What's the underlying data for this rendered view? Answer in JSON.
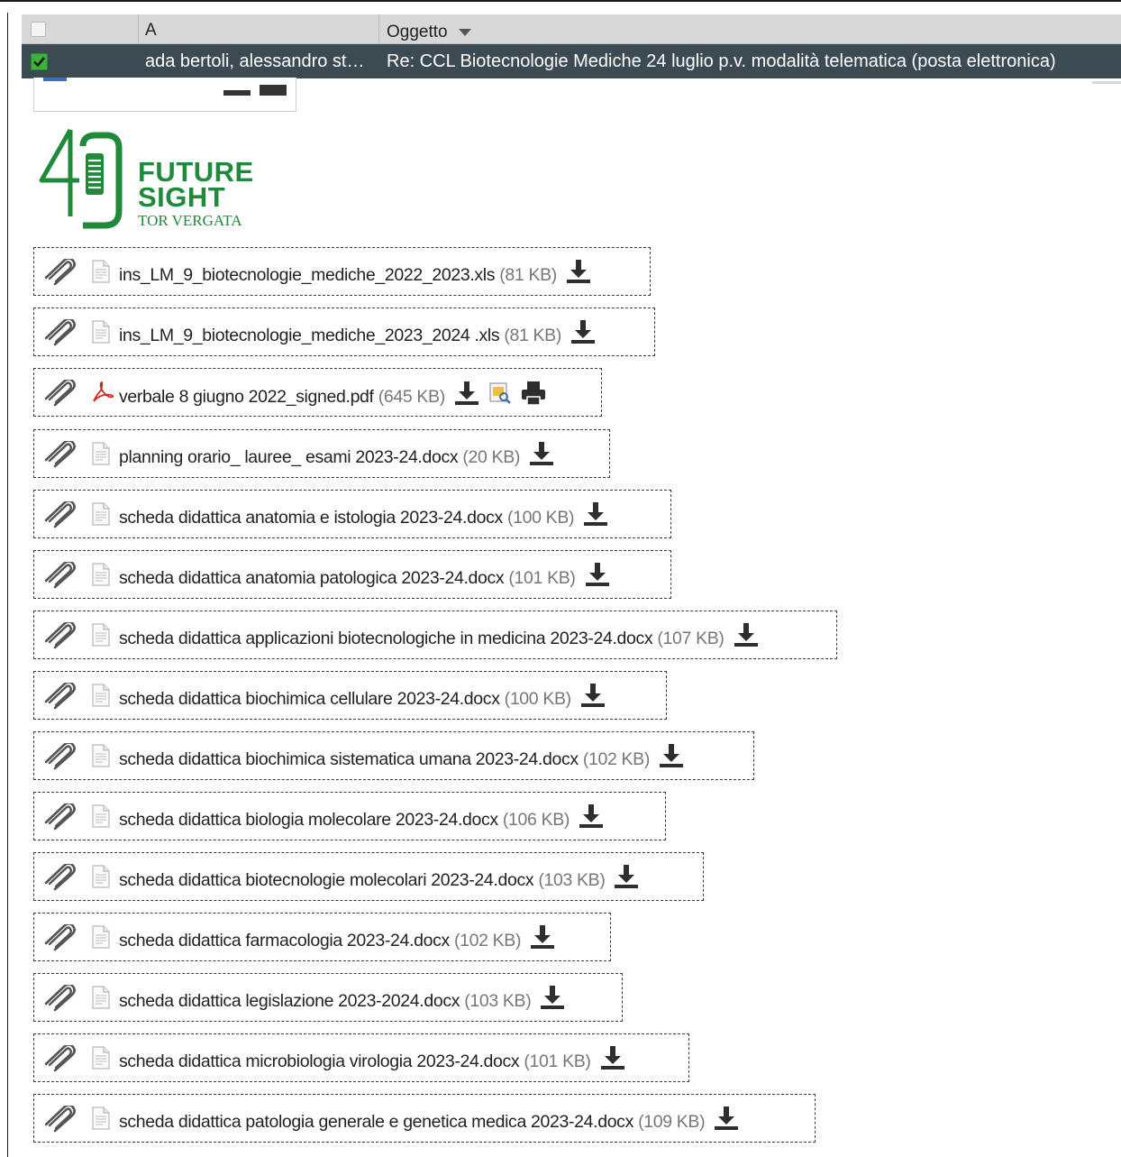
{
  "mail_list": {
    "columns": {
      "from_label": "A",
      "subject_label": "Oggetto"
    },
    "selected_row": {
      "from": "ada bertoli, alessandro st…",
      "subject": "Re: CCL Biotecnologie Mediche 24 luglio p.v. modalità telematica (posta elettronica)"
    }
  },
  "logo": {
    "number": "40",
    "line1": "FUTURE",
    "line2": "SIGHT",
    "line3": "TOR VERGATA",
    "color": "#1f8a3a"
  },
  "attachments": [
    {
      "name": "ins_LM_9_biotecnologie_mediche_2022_2023.xls",
      "size": "(81 KB)",
      "type": "file"
    },
    {
      "name": "ins_LM_9_biotecnologie_mediche_2023_2024 .xls",
      "size": "(81 KB)",
      "type": "file"
    },
    {
      "name": "verbale 8 giugno 2022_signed.pdf",
      "size": "(645 KB)",
      "type": "pdf"
    },
    {
      "name": "planning orario_ lauree_ esami 2023-24.docx",
      "size": "(20 KB)",
      "type": "file"
    },
    {
      "name": "scheda didattica anatomia e istologia 2023-24.docx",
      "size": "(100 KB)",
      "type": "file"
    },
    {
      "name": "scheda didattica anatomia patologica 2023-24.docx",
      "size": "(101 KB)",
      "type": "file"
    },
    {
      "name": "scheda didattica applicazioni biotecnologiche in medicina 2023-24.docx",
      "size": "(107 KB)",
      "type": "file"
    },
    {
      "name": "scheda didattica biochimica cellulare 2023-24.docx",
      "size": "(100 KB)",
      "type": "file"
    },
    {
      "name": "scheda didattica biochimica sistematica umana 2023-24.docx",
      "size": "(102 KB)",
      "type": "file"
    },
    {
      "name": "scheda didattica biologia molecolare 2023-24.docx",
      "size": "(106 KB)",
      "type": "file"
    },
    {
      "name": "scheda didattica biotecnologie molecolari 2023-24.docx",
      "size": "(103 KB)",
      "type": "file"
    },
    {
      "name": "scheda didattica farmacologia 2023-24.docx",
      "size": "(102 KB)",
      "type": "file"
    },
    {
      "name": "scheda didattica legislazione 2023-2024.docx",
      "size": "(103 KB)",
      "type": "file"
    },
    {
      "name": "scheda didattica microbiologia virologia 2023-24.docx",
      "size": "(101 KB)",
      "type": "file"
    },
    {
      "name": "scheda didattica patologia generale e genetica medica 2023-24.docx",
      "size": "(109 KB)",
      "type": "file"
    }
  ],
  "icons": {
    "attachment": "paperclip-icon",
    "file": "document-icon",
    "pdf": "pdf-icon",
    "download": "download-icon",
    "preview": "preview-icon",
    "print": "print-icon"
  }
}
